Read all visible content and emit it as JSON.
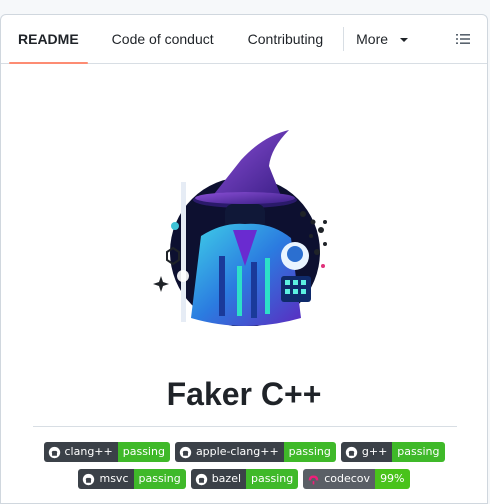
{
  "tabs": [
    {
      "label": "README",
      "active": true
    },
    {
      "label": "Code of conduct",
      "active": false
    },
    {
      "label": "Contributing",
      "active": false
    },
    {
      "label": "More",
      "active": false
    }
  ],
  "readme": {
    "title": "Faker C++"
  },
  "badges_row1": [
    {
      "label": "clang++",
      "value": "passing",
      "icon": "github-icon"
    },
    {
      "label": "apple-clang++",
      "value": "passing",
      "icon": "github-icon"
    },
    {
      "label": "g++",
      "value": "passing",
      "icon": "github-icon"
    }
  ],
  "badges_row2": [
    {
      "label": "msvc",
      "value": "passing",
      "icon": "github-icon"
    },
    {
      "label": "bazel",
      "value": "passing",
      "icon": "github-icon"
    },
    {
      "label": "codecov",
      "value": "99%",
      "icon": "codecov-icon"
    }
  ],
  "colors": {
    "active_tab_underline": "#fd8c73",
    "badge_label_bg": "#3b4148",
    "badge_passing_bg": "#3fb929"
  }
}
